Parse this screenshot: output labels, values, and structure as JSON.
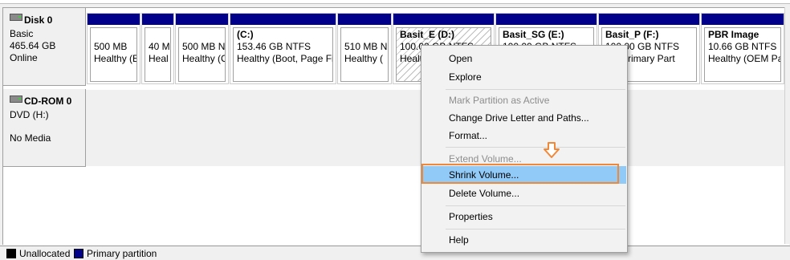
{
  "colors": {
    "primary_partition": "#00008b",
    "unallocated": "#000000",
    "highlight": "#91c9f7",
    "callout": "#f0883a"
  },
  "disk0": {
    "name": "Disk 0",
    "type": "Basic",
    "size": "465.64 GB",
    "status": "Online",
    "icon": "hard-disk-icon"
  },
  "partitions": [
    {
      "title": "",
      "size": "500 MB",
      "status": "Healthy (E"
    },
    {
      "title": "",
      "size": "40 M",
      "status": "Heal"
    },
    {
      "title": "",
      "size": "500 MB N",
      "status": "Healthy (C"
    },
    {
      "title": "(C:)",
      "size": "153.46 GB NTFS",
      "status": "Healthy (Boot, Page Fi"
    },
    {
      "title": "",
      "size": "510 MB N",
      "status": "Healthy ("
    },
    {
      "title": "Basit_E  (D:)",
      "size": "100.00 GB NTFS",
      "status": "Healt"
    },
    {
      "title": "Basit_SG  (E:)",
      "size": "100.00 GB NTFS",
      "status": ""
    },
    {
      "title": "Basit_P  (F:)",
      "size": "100.00 GB NTFS",
      "status": "hy (Primary Part"
    },
    {
      "title": "PBR Image",
      "size": "10.66 GB NTFS",
      "status": "Healthy (OEM Pa"
    }
  ],
  "cdrom": {
    "name": "CD-ROM 0",
    "type": "DVD (H:)",
    "media": "No Media",
    "icon": "cd-drive-icon"
  },
  "context_menu": {
    "open": "Open",
    "explore": "Explore",
    "mark_active": "Mark Partition as Active",
    "change_letter": "Change Drive Letter and Paths...",
    "format": "Format...",
    "extend": "Extend Volume...",
    "shrink": "Shrink Volume...",
    "delete": "Delete Volume...",
    "properties": "Properties",
    "help": "Help"
  },
  "legend": {
    "unallocated": "Unallocated",
    "primary": "Primary partition"
  }
}
